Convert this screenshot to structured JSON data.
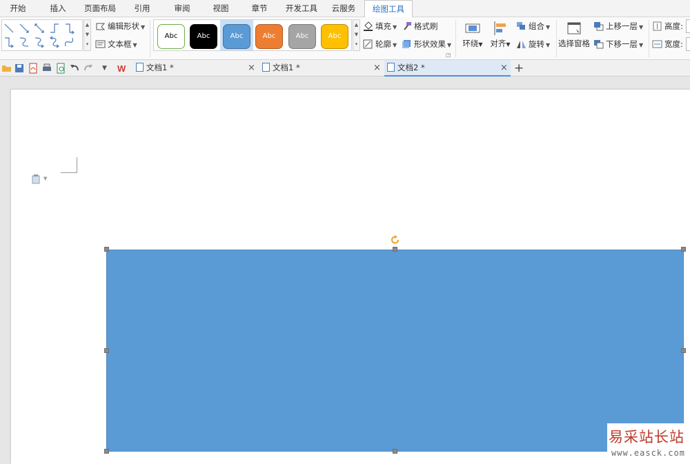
{
  "menu": {
    "tabs": [
      "开始",
      "插入",
      "页面布局",
      "引用",
      "审阅",
      "视图",
      "章节",
      "开发工具",
      "云服务",
      "绘图工具"
    ],
    "active": "绘图工具"
  },
  "ribbon": {
    "edit_shape": "编辑形状",
    "text_box": "文本框",
    "style_label": "Abc",
    "styles": [
      {
        "name": "white",
        "fill": "#ffffff",
        "border": "#70ad47",
        "text": "#000000"
      },
      {
        "name": "black",
        "fill": "#000000",
        "border": "#000000",
        "text": "#ffffff"
      },
      {
        "name": "blue",
        "fill": "#5b9bd5",
        "border": "#41719c",
        "text": "#ffffff"
      },
      {
        "name": "orange",
        "fill": "#ed7d31",
        "border": "#ae5a21",
        "text": "#ffffff"
      },
      {
        "name": "gray",
        "fill": "#a5a5a5",
        "border": "#787878",
        "text": "#ffffff"
      },
      {
        "name": "gold",
        "fill": "#ffc000",
        "border": "#bc8c00",
        "text": "#ffffff"
      }
    ],
    "fill": "填充",
    "format_painter": "格式刷",
    "outline": "轮廓",
    "shape_effects": "形状效果",
    "wrap": "环绕",
    "align": "对齐",
    "group": "组合",
    "rotate": "旋转",
    "selection_pane": "选择窗格",
    "bring_forward": "上移一层",
    "send_backward": "下移一层",
    "height": "高度:",
    "width": "宽度:"
  },
  "doc_tabs": [
    {
      "title": "文档1 *",
      "active": false
    },
    {
      "title": "文档1 *",
      "active": false
    },
    {
      "title": "文档2 *",
      "active": true
    }
  ],
  "shape": {
    "fill": "#5b9bd5",
    "type": "rectangle",
    "selected": true
  },
  "watermark": {
    "cn": "易采站长站",
    "url": "www.easck.com"
  }
}
